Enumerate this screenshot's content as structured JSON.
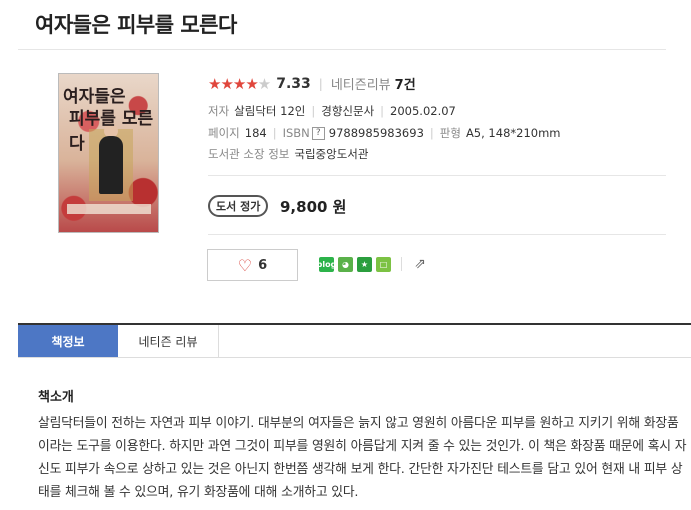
{
  "book": {
    "title": "여자들은 피부를 모른다",
    "cover_text_1": "여자들은",
    "cover_text_2": "피부를 모른다"
  },
  "rating": {
    "stars_on": "★★★★",
    "stars_off": "★",
    "score": "7.33",
    "review_label": "네티즌리뷰",
    "review_count": "7건"
  },
  "info": {
    "author_label": "저자",
    "author": "살림닥터 12인",
    "publisher": "경향신문사",
    "date": "2005.02.07",
    "pages_label": "페이지",
    "pages": "184",
    "isbn_label": "ISBN",
    "isbn_help": "?",
    "isbn": "9788985983693",
    "size_label": "판형",
    "size": "A5, 148*210mm",
    "library_label": "도서관 소장 정보",
    "library": "국립중앙도서관"
  },
  "price": {
    "badge": "도서 정가",
    "value": "9,800 원"
  },
  "like": {
    "count": "6"
  },
  "share": {
    "blog": "blog"
  },
  "tabs": {
    "info": "책정보",
    "reviews": "네티즌 리뷰"
  },
  "intro": {
    "title": "책소개",
    "text": "살림닥터들이 전하는 자연과 피부 이야기. 대부분의 여자들은 늙지 않고 영원히 아름다운 피부를 원하고 지키기 위해 화장품이라는 도구를 이용한다. 하지만 과연 그것이 피부를 영원히 아름답게 지켜 줄 수 있는 것인가. 이 책은 화장품 때문에 혹시 자신도 피부가 속으로 상하고 있는 것은 아닌지 한번쯤 생각해 보게 한다. 간단한 자가진단 테스트를 담고 있어 현재 내 피부 상태를 체크해 볼 수 있으며, 유기 화장품에 대해 소개하고 있다."
  },
  "colors": {
    "star": "#e0463c",
    "tab_active": "#4d77c5",
    "heart": "#d8413a"
  }
}
